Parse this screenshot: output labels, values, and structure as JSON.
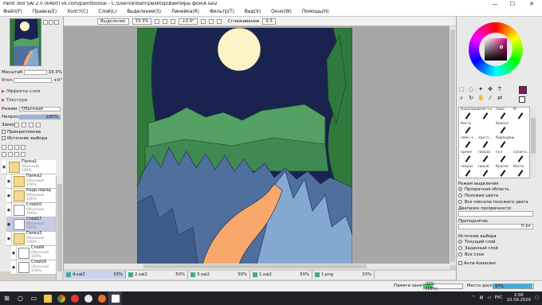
{
  "titlebar": {
    "title": "Paint Tool SAI 2.0 (64bit) vk.com/painttoolsai - C:\\Users\\kidam\\Desktop\\Вампиры фон\\4.sai2",
    "minimize": "—",
    "maximize": "☐",
    "close": "✕"
  },
  "menu": [
    "Файл(F)",
    "Правка(E)",
    "Холст(C)",
    "Слой(L)",
    "Выделение(S)",
    "Линейка(R)",
    "Фильтр(T)",
    "Вид(V)",
    "Окно(W)",
    "Помощь(H)"
  ],
  "navigator": {
    "scale_label": "Масштаб",
    "scale_value": "33.3%",
    "angle_label": "Угол",
    "angle_value": "+0°"
  },
  "left_sections": {
    "effects": "Эффекты слоя",
    "texture": "Текстура",
    "mode_label": "Режим",
    "mode_value": "Обычный",
    "opacity_label": "Непроз.",
    "opacity_value": "100%",
    "lock_label": "Замок",
    "clip_label": "Прикрепление",
    "source_label": "Источник выбора"
  },
  "layers": [
    {
      "name": "Папка1",
      "mode": "Обычный",
      "opacity": "100%",
      "kind": "folder"
    },
    {
      "name": "Папка2",
      "mode": "Обычный",
      "opacity": "100%",
      "kind": "folder"
    },
    {
      "name": "Кадр перед",
      "mode": "Обычный",
      "opacity": "100%",
      "kind": "folder"
    },
    {
      "name": "Слой10",
      "mode": "Обычный",
      "opacity": "100%",
      "kind": "layer"
    },
    {
      "name": "Слой17",
      "mode": "Обычный",
      "opacity": "100%",
      "kind": "layer",
      "selected": true
    },
    {
      "name": "Папка3",
      "mode": "Обычный",
      "opacity": "100%",
      "kind": "folder"
    },
    {
      "name": "Слой9",
      "mode": "Обычный",
      "opacity": "100%",
      "kind": "layer"
    },
    {
      "name": "Слой16",
      "mode": "Обычный",
      "opacity": "100%",
      "kind": "layer"
    }
  ],
  "canvas_toolbar": {
    "selection_label": "Выделение",
    "zoom_value": "33.3%",
    "rotation_value": "+0.0°",
    "stabilizer_label": "Сглаживание",
    "stabilizer_value": "S-3"
  },
  "doc_tabs": [
    {
      "name": "4.sai2",
      "zoom": "33%",
      "active": true
    },
    {
      "name": "2.sai2",
      "zoom": "50%"
    },
    {
      "name": "3.sai2",
      "zoom": "50%"
    },
    {
      "name": "1.sai2",
      "zoom": "50%"
    },
    {
      "name": "1.png",
      "zoom": "33%"
    }
  ],
  "colors": {
    "main_color": "#8b1368",
    "sky": "#1a2350",
    "moon": "#fbf4c7",
    "hills": "#53a163",
    "forest_green": "#2f7a3b",
    "trees_blue": "#4f6f9c",
    "trees_light": "#84a9d1",
    "path": "#f7a86a"
  },
  "brushes": [
    [
      "",
      "",
      "",
      "",
      ""
    ],
    [
      "Карандаш",
      "смягч-н",
      "перо",
      "",
      "Ф"
    ],
    [
      "Кисть",
      "",
      "",
      "Краска",
      ""
    ],
    [
      "лайн +",
      "кругл...",
      "Карандаш",
      "",
      ""
    ],
    [
      "",
      "",
      "",
      "",
      ""
    ],
    [
      "кремл",
      "покрас",
      "нсл",
      "сухая к...",
      ""
    ],
    [
      "",
      "",
      "",
      "",
      ""
    ],
    [
      "покрас",
      "ников",
      "Краска",
      "Кисть",
      ""
    ],
    [
      "",
      "",
      "",
      "",
      ""
    ]
  ],
  "selection_mode": {
    "title": "Режим выделения",
    "options": [
      "Прозрачная область",
      "Похожие цвета",
      "Все пиксели похожего цвета"
    ],
    "selected": 0,
    "transparency_label": "Диапазон прозрачности",
    "transparency_value": "",
    "blur_label": "Приподнятие",
    "blur_value": "0 px"
  },
  "selection_source": {
    "title": "Источник выбора",
    "options": [
      "Текущий слой",
      "Заданный слой",
      "Все слои"
    ],
    "selected": 0,
    "antialias": "Анти-Алиасинг"
  },
  "status": {
    "memory_label": "Памяти занято",
    "memory_value": "22% (15%)",
    "memory_fraction": 0.22,
    "disk_label": "Место диска",
    "disk_value": "97%",
    "disk_fraction": 0.97
  },
  "taskbar": {
    "lang": "РУС",
    "time": "2:06",
    "date": "10.09.2020"
  }
}
